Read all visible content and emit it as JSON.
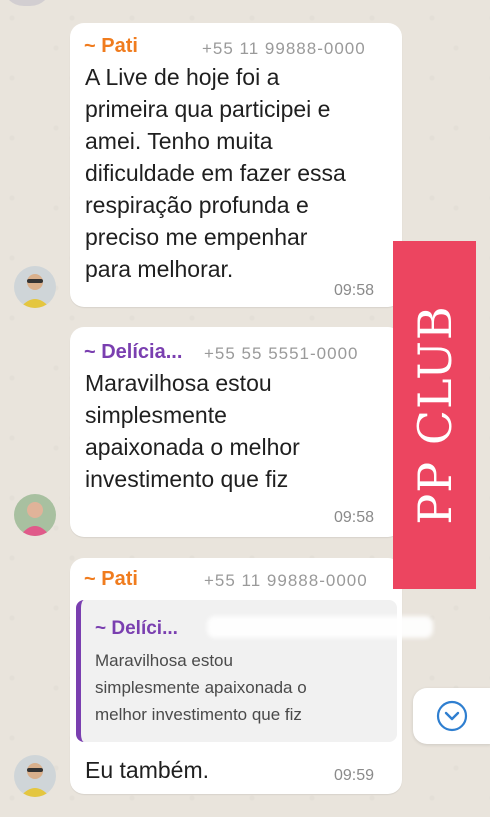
{
  "messages": [
    {
      "sender": "~ Pati",
      "sender_color": "#f07c1e",
      "phone": "+55 11 99888-0000",
      "text_lines": [
        "A Live de hoje foi a",
        "primeira qua participei e",
        "amei. Tenho muita",
        "dificuldade em fazer essa",
        "respiração profunda e",
        "preciso me empenhar",
        "para melhorar."
      ],
      "time": "09:58"
    },
    {
      "sender": "~ Delícia...",
      "sender_color": "#7a3fb0",
      "phone": "+55 55 5551-0000",
      "text_lines": [
        "Maravilhosa estou",
        "simplesmente",
        "apaixonada o melhor",
        "investimento que fiz"
      ],
      "time": "09:58"
    },
    {
      "sender": "~ Pati",
      "sender_color": "#f07c1e",
      "phone": "+55 11 99888-0000",
      "quote": {
        "sender": "~ Delíci...",
        "lines": [
          "Maravilhosa estou",
          "simplesmente apaixonada o",
          "melhor investimento que fiz"
        ]
      },
      "text_lines": [
        "Eu também."
      ],
      "time": "09:59"
    }
  ],
  "banner": {
    "text": "PP CLUB",
    "color": "#ec4560"
  },
  "scroll_button": {
    "icon": "chevron-down-icon",
    "color": "#2f7fd0"
  }
}
